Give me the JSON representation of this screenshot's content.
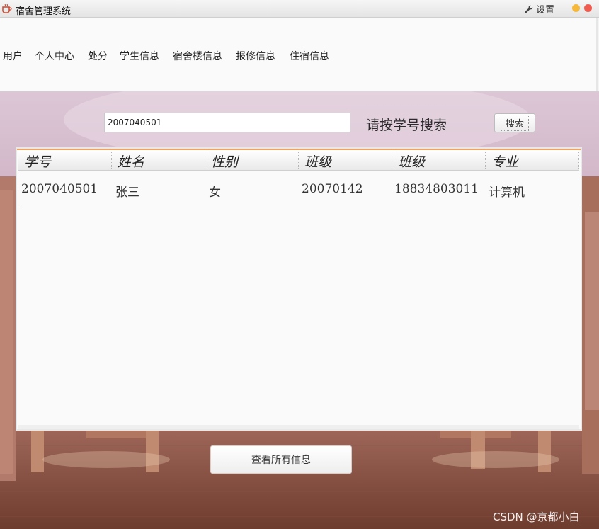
{
  "window": {
    "title": "宿舍管理系统",
    "settings_label": "设置",
    "settings_icon": "wrench-icon",
    "app_icon": "coffee-cup-icon",
    "minimize_color": "#f5b83a",
    "close_color": "#ef5b4f"
  },
  "menu": {
    "items": [
      {
        "label": "用户"
      },
      {
        "label": "个人中心"
      },
      {
        "label": "处分"
      },
      {
        "label": "学生信息"
      },
      {
        "label": "宿舍楼信息"
      },
      {
        "label": "报修信息"
      },
      {
        "label": "住宿信息"
      }
    ]
  },
  "search": {
    "value": "2007040501",
    "hint": "请按学号搜索",
    "button_label": "搜索"
  },
  "table": {
    "columns": [
      "学号",
      "姓名",
      "性别",
      "班级",
      "班级",
      "专业"
    ],
    "rows": [
      [
        "2007040501",
        "张三",
        "女",
        "20070142",
        "18834803011",
        "计算机"
      ]
    ]
  },
  "actions": {
    "view_all_label": "查看所有信息"
  },
  "watermark": "CSDN @京都小白",
  "colors": {
    "table_accent": "#f0a460"
  }
}
